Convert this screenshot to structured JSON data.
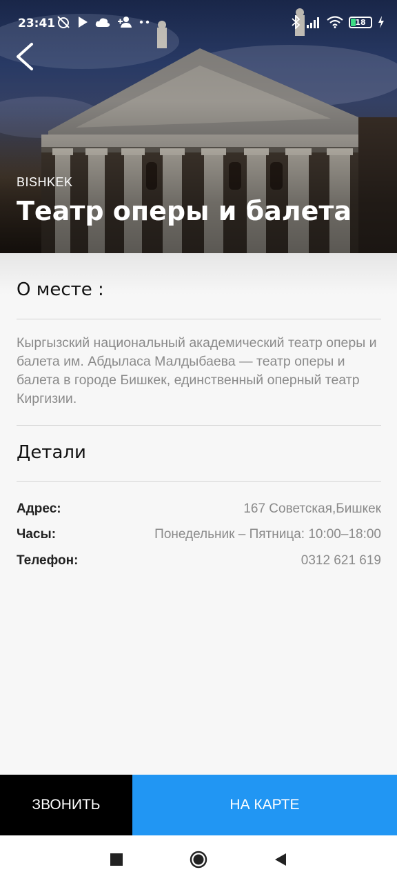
{
  "status_bar": {
    "time": "23:41",
    "battery_level": "18",
    "battery_color": "#3ddc84",
    "left_icons": [
      "alarm-off-icon",
      "play-icon",
      "cloud-icon",
      "person-add-icon",
      "more-dots-icon"
    ],
    "right_icons": [
      "bluetooth-icon",
      "signal-icon",
      "wifi-icon",
      "battery-icon",
      "charging-icon"
    ]
  },
  "header": {
    "city": "BISHKEK",
    "title": "Театр оперы и балета"
  },
  "about": {
    "heading": "О месте :",
    "description": "Кыргызский национальный академический театр оперы и балета им. Абдыласа Малдыбаева — театр оперы и балета в городе Бишкек, единственный оперный театр Киргизии."
  },
  "details": {
    "heading": "Детали",
    "rows": [
      {
        "label": "Адрес:",
        "value": "167 Советская,Бишкек"
      },
      {
        "label": "Часы:",
        "value": "Понедельник – Пятница: 10:00–18:00"
      },
      {
        "label": "Телефон:",
        "value": "0312 621 619"
      }
    ]
  },
  "actions": {
    "call_label": "ЗВОНИТЬ",
    "map_label": "НА КАРТЕ",
    "call_color": "#000000",
    "map_color": "#2196f3"
  },
  "nav": {
    "icons": [
      "recents-square-icon",
      "home-circle-icon",
      "back-triangle-icon"
    ]
  }
}
